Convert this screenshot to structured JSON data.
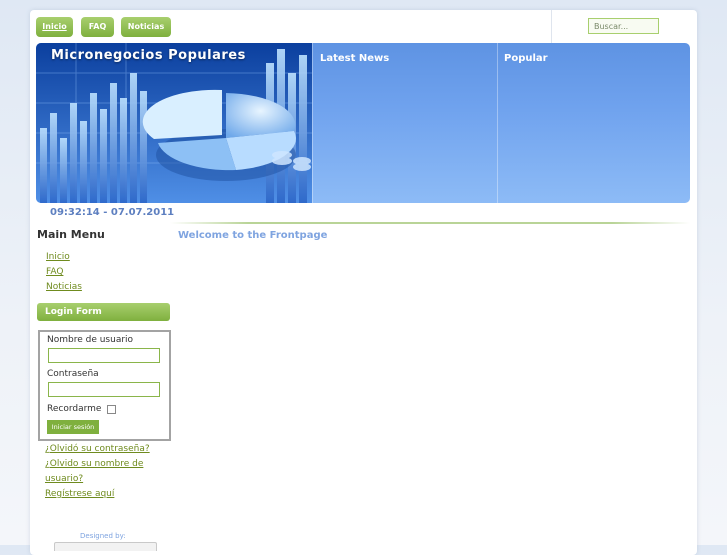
{
  "nav": {
    "items": [
      {
        "label": "Inicio",
        "active": true
      },
      {
        "label": "FAQ",
        "active": false
      },
      {
        "label": "Noticias",
        "active": false
      }
    ],
    "search_placeholder": "Buscar..."
  },
  "header": {
    "site_title": "Micronegocios Populares",
    "columns": [
      {
        "label": "Latest News"
      },
      {
        "label": "Popular"
      }
    ]
  },
  "clock": "09:32:14 - 07.07.2011",
  "main": {
    "welcome": "Welcome to the Frontpage"
  },
  "sidebar": {
    "menu_title": "Main Menu",
    "menu_items": [
      {
        "label": "Inicio"
      },
      {
        "label": "FAQ"
      },
      {
        "label": "Noticias"
      }
    ]
  },
  "login": {
    "title": "Login Form",
    "username_label": "Nombre de usuario",
    "password_label": "Contraseña",
    "remember_label": "Recordarme",
    "submit_label": "Iniciar sesión",
    "forgot_password": "¿Olvidó su contraseña?",
    "forgot_username_line1": "¿Olvido su nombre de",
    "forgot_username_line2": "usuario?",
    "register": "Regístrese aquí"
  },
  "footer": {
    "designed_by": "Designed by:"
  },
  "colors": {
    "accent_green": "#7fb03e",
    "banner_blue": "#6fa2ee",
    "link_green": "#6f8b1e"
  }
}
